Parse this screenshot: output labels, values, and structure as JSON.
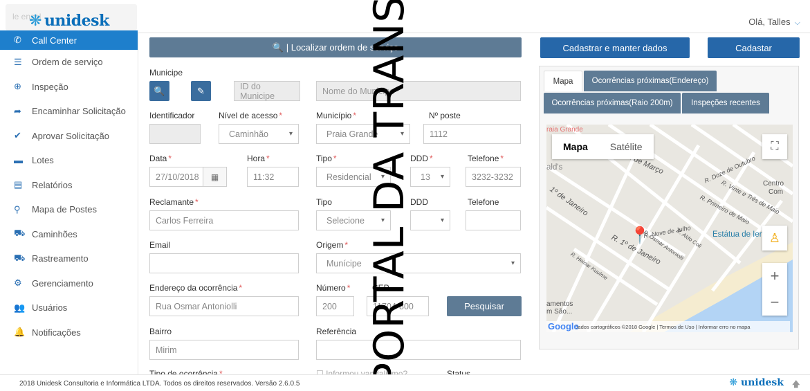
{
  "header": {
    "logo_text": "unidesk",
    "faded_text": "le       ensal",
    "greeting": "Olá, Talles"
  },
  "sidebar": {
    "items": [
      {
        "label": "Call Center",
        "icon": "phone-icon",
        "glyph": "✆",
        "active": true
      },
      {
        "label": "Ordem de serviço",
        "icon": "list-icon",
        "glyph": "☰"
      },
      {
        "label": "Inspeção",
        "icon": "binoculars-icon",
        "glyph": "⊕"
      },
      {
        "label": "Encaminhar Solicitação",
        "icon": "share-icon",
        "glyph": "➦"
      },
      {
        "label": "Aprovar Solicitação",
        "icon": "check-icon",
        "glyph": "✔"
      },
      {
        "label": "Lotes",
        "icon": "inbox-icon",
        "glyph": "▬"
      },
      {
        "label": "Relatórios",
        "icon": "file-icon",
        "glyph": "▤"
      },
      {
        "label": "Mapa de Postes",
        "icon": "map-marker-icon",
        "glyph": "⚲"
      },
      {
        "label": "Caminhões",
        "icon": "truck-icon",
        "glyph": "⛟"
      },
      {
        "label": "Rastreamento",
        "icon": "truck-tracking-icon",
        "glyph": "⛟"
      },
      {
        "label": "Gerenciamento",
        "icon": "gear-icon",
        "glyph": "⚙"
      },
      {
        "label": "Usuários",
        "icon": "users-icon",
        "glyph": "👥"
      },
      {
        "label": "Notificações",
        "icon": "bell-icon",
        "glyph": "🔔"
      }
    ]
  },
  "form": {
    "search_button": "🔍 | Localizar ordem de serviço",
    "municipe_label": "Municipe",
    "id_municipe_placeholder": "ID do Municipe",
    "nome_municipe_placeholder": "Nome do Municipe",
    "identificador_label": "Identificador",
    "nivel_acesso_label": "Nível de acesso",
    "nivel_acesso_value": "Caminhão",
    "municipio_label": "Município",
    "municipio_value": "Praia Grande",
    "nposte_label": "Nº poste",
    "nposte_value": "1112",
    "data_label": "Data",
    "data_value": "27/10/2018",
    "hora_label": "Hora",
    "hora_value": "11:32",
    "tipo_label": "Tipo",
    "tipo_value": "Residencial",
    "ddd_label": "DDD",
    "ddd_value": "13",
    "telefone_label": "Telefone",
    "telefone_value": "3232-3232",
    "reclamante_label": "Reclamante",
    "reclamante_value": "Carlos Ferreira",
    "tipo2_label": "Tipo",
    "tipo2_value": "Selecione",
    "ddd2_label": "DDD",
    "telefone2_label": "Telefone",
    "email_label": "Email",
    "origem_label": "Origem",
    "origem_value": "Munícipe",
    "endereco_label": "Endereço da ocorrência",
    "endereco_value": "Rua Osmar Antoniolli",
    "numero_label": "Número",
    "numero_value": "200",
    "cep_label": "CEP",
    "cep_value": "11704-800",
    "pesquisar_button": "Pesquisar",
    "bairro_label": "Bairro",
    "bairro_value": "Mirim",
    "referencia_label": "Referência",
    "tipo_ocorrencia_label": "Tipo de ocorrência",
    "informou_label": "Informou vandalismo?",
    "status_label": "Status"
  },
  "right": {
    "cadastrar_manter": "Cadastrar e manter dados",
    "cadastar": "Cadastar",
    "tabs": [
      "Mapa",
      "Ocorrências próximas(Endereço)",
      "Ocorrências próximas(Raio 200m)",
      "Inspeções recentes"
    ],
    "map_type_map": "Mapa",
    "map_type_sat": "Satélite",
    "map_footer": "Dados cartográficos ©2018 Google  |  Termos de Uso  |  Informar erro no mapa",
    "google": "Google",
    "streets": {
      "s1": "31 de Março",
      "s2": "R. Doze de Outubro",
      "s3": "R. Vinte e Três de Maio",
      "s4": "R. Primeiro de Maio",
      "s5": "R. Nove de Julho",
      "s6": "R. 1º de Janeiro",
      "s7": "R. Osmar Antoniolli",
      "s8": "R. Aldo Coli",
      "s9": "R. Heinar Kuulme",
      "s10": "1º de Janeiro"
    },
    "places": {
      "estatua": "Estátua de Ier",
      "centro": "Centro",
      "com": "Com",
      "alds": "ald's",
      "pg": "raia Grande",
      "mentos": "amentos",
      "sao": "m São..."
    }
  },
  "footer": {
    "copyright": "2018 Unidesk Consultoria e Informática LTDA. Todos os direitos reservados.    Versão 2.6.0.5",
    "logo": "unidesk"
  },
  "watermark": "PORTAL DA TRANSP",
  "colors": {
    "primary": "#1e7fcc",
    "button_dark": "#2667a9",
    "slate": "#5e7b95",
    "required": "#e05a5a"
  }
}
